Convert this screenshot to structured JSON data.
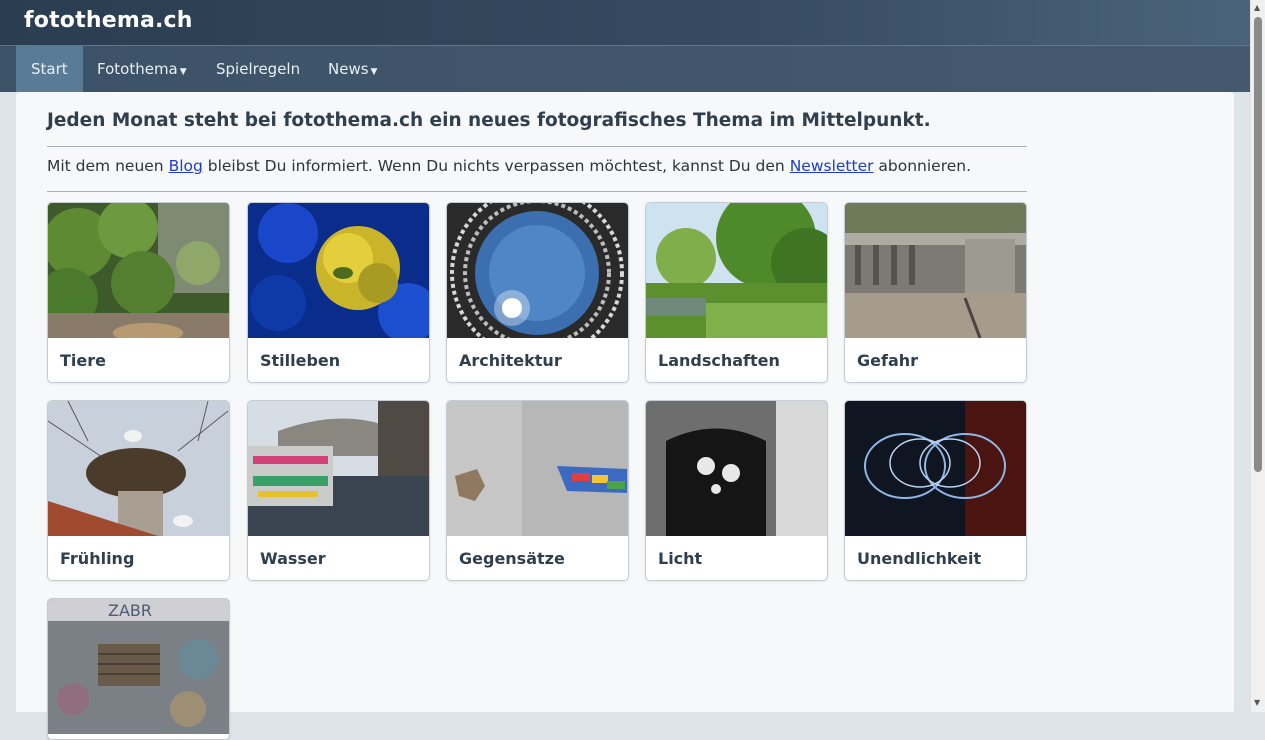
{
  "brand": "fotothema.ch",
  "nav": [
    {
      "label": "Start",
      "dropdown": false,
      "active": true
    },
    {
      "label": "Fotothema",
      "dropdown": true,
      "active": false
    },
    {
      "label": "Spielregeln",
      "dropdown": false,
      "active": false
    },
    {
      "label": "News",
      "dropdown": true,
      "active": false
    }
  ],
  "headline": "Jeden Monat steht bei fotothema.ch ein neues fotografisches Thema im Mittelpunkt.",
  "intro": {
    "part1": "Mit dem neuen ",
    "blog_link": "Blog",
    "part2": " bleibst Du informiert. Wenn Du nichts verpassen möchtest, kannst Du den ",
    "newsletter_link": "Newsletter",
    "part3": " abonnieren."
  },
  "themes": [
    {
      "title": "Tiere",
      "image": "photo-bushes-animal"
    },
    {
      "title": "Stilleben",
      "image": "photo-yellow-flower-blue"
    },
    {
      "title": "Architektur",
      "image": "photo-tunnel-sky"
    },
    {
      "title": "Landschaften",
      "image": "photo-pond-trees"
    },
    {
      "title": "Gefahr",
      "image": "photo-stone-bridge"
    },
    {
      "title": "Frühling",
      "image": "photo-stork-nest"
    },
    {
      "title": "Wasser",
      "image": "photo-boat-bridge"
    },
    {
      "title": "Gegensätze",
      "image": "photo-wall-lego"
    },
    {
      "title": "Licht",
      "image": "photo-shadow-flowers"
    },
    {
      "title": "Unendlichkeit",
      "image": "photo-light-trails"
    },
    {
      "title": "",
      "image": "photo-graffiti-wall"
    }
  ],
  "colors": {
    "topbar": "#2b3d50",
    "navbar": "#45596e",
    "nav_active": "#5a7b95",
    "link": "#1f3ccf",
    "card_title": "#2f3f4e"
  }
}
